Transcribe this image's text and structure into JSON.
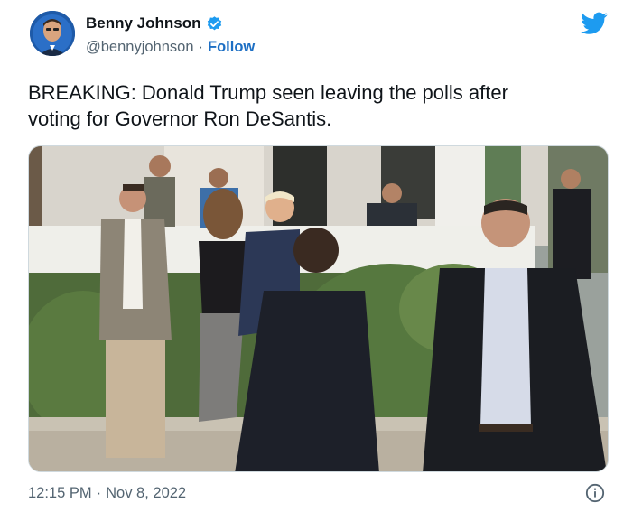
{
  "author": {
    "name": "Benny Johnson",
    "handle": "@bennyjohnson",
    "separator": "·",
    "follow_label": "Follow",
    "verified": true
  },
  "tweet": {
    "text_line1": "BREAKING: Donald Trump seen leaving the polls after",
    "text_line2": "voting for Governor Ron DeSantis."
  },
  "meta": {
    "time": "12:15 PM",
    "separator": "·",
    "date": "Nov 8, 2022"
  },
  "icons": {
    "platform": "twitter-bird-icon",
    "verified": "verified-badge-icon",
    "info": "info-icon"
  },
  "colors": {
    "twitter_blue": "#1d9bf0",
    "follow_text": "#1d6fc4",
    "secondary_text": "#536471"
  }
}
